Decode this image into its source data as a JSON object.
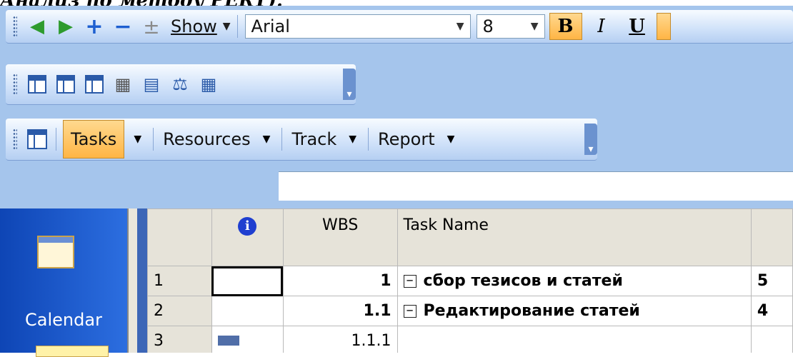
{
  "caption": "Анализ по методу PERT).",
  "toolbar1": {
    "items": [
      {
        "icon": "outdent-arrow-icon",
        "glyph": "🡸",
        "color": "#2e9b2e"
      },
      {
        "icon": "indent-arrow-icon",
        "glyph": "🡺",
        "color": "#2e9b2e"
      },
      {
        "icon": "show-subtasks-icon",
        "glyph": "+",
        "color": "#1e5fd0"
      },
      {
        "icon": "hide-subtasks-icon",
        "glyph": "−",
        "color": "#1e5fd0"
      },
      {
        "icon": "show-levels-icon",
        "glyph": "±",
        "color": "#888888"
      }
    ],
    "show_label": "Show",
    "font_name": "Arial",
    "font_size": "8",
    "bold_label": "B",
    "italic_label": "I",
    "underline_label": "U"
  },
  "toolbar2": {
    "icons": [
      "view-table-icon",
      "view-table2-icon",
      "view-table3-icon",
      "calculator-icon",
      "details-icon",
      "balance-icon",
      "grid-table-icon"
    ]
  },
  "toolbar3": {
    "tasks_label": "Tasks",
    "resources_label": "Resources",
    "track_label": "Track",
    "report_label": "Report"
  },
  "viewbar": {
    "calendar_label": "Calendar"
  },
  "grid": {
    "headers": {
      "info": "i",
      "wbs": "WBS",
      "task_name": "Task Name"
    },
    "rows": [
      {
        "id": "1",
        "wbs": "1",
        "name": "сбор тезисов и статей",
        "dur": "5"
      },
      {
        "id": "2",
        "wbs": "1.1",
        "name": "Редактирование статей",
        "dur": "4"
      },
      {
        "id": "3",
        "wbs": "1.1.1",
        "name": "",
        "dur": ""
      }
    ]
  }
}
